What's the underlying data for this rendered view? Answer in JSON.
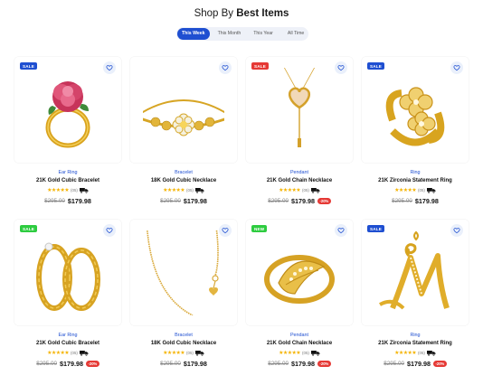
{
  "heading": {
    "prefix": "Shop By",
    "bold": "Best Items"
  },
  "tabs": [
    {
      "label": "This Week",
      "active": true
    },
    {
      "label": "This Month",
      "active": false
    },
    {
      "label": "This Year",
      "active": false
    },
    {
      "label": "All Time",
      "active": false
    }
  ],
  "colors": {
    "accent": "#1f4fd1",
    "sale": "#1f4fd1",
    "hot": "#e53935",
    "sale_green": "#2ecc40",
    "new": "#2ecc40",
    "star": "#f5b301",
    "gold": "#e0a820"
  },
  "products": [
    {
      "badge": "SALE",
      "category": "Ear Ring",
      "name": "21K Gold Cubic Bracelet",
      "stars": "★★★★★",
      "reviews": "(05)",
      "old_price": "$295.00",
      "price": "$179.98",
      "discount": "",
      "icon": "rose-ring-icon"
    },
    {
      "badge": "",
      "category": "Bracelet",
      "name": "18K Gold Cubic Necklace",
      "stars": "★★★★★",
      "reviews": "(05)",
      "old_price": "$295.00",
      "price": "$179.98",
      "discount": "",
      "icon": "flower-bracelet-icon"
    },
    {
      "badge": "SALE",
      "category": "Pendant",
      "name": "21K Gold Chain Necklace",
      "stars": "★★★★★",
      "reviews": "(05)",
      "old_price": "$295.00",
      "price": "$179.98",
      "discount": "-20%",
      "icon": "heart-pendant-icon"
    },
    {
      "badge": "SALE",
      "category": "Ring",
      "name": "21K Zirconia Statement Ring",
      "stars": "★★★★★",
      "reviews": "(05)",
      "old_price": "$295.00",
      "price": "$179.98",
      "discount": "",
      "icon": "clover-ring-icon"
    },
    {
      "badge": "SALE",
      "category": "Ear Ring",
      "name": "21K Gold Cubic Bracelet",
      "stars": "★★★★★",
      "reviews": "(05)",
      "old_price": "$295.00",
      "price": "$179.98",
      "discount": "-20%",
      "icon": "filigree-rings-icon"
    },
    {
      "badge": "",
      "category": "Bracelet",
      "name": "18K Gold Cubic Necklace",
      "stars": "★★★★★",
      "reviews": "(05)",
      "old_price": "$295.00",
      "price": "$179.98",
      "discount": "",
      "icon": "chain-necklace-icon"
    },
    {
      "badge": "NEW",
      "category": "Pendant",
      "name": "21K Gold Chain Necklace",
      "stars": "★★★★★",
      "reviews": "(05)",
      "old_price": "$295.00",
      "price": "$179.98",
      "discount": "-20%",
      "icon": "leaf-ring-icon"
    },
    {
      "badge": "SALE",
      "category": "Ring",
      "name": "21K Zirconia Statement Ring",
      "stars": "★★★★★",
      "reviews": "(05)",
      "old_price": "$295.00",
      "price": "$179.98",
      "discount": "-20%",
      "icon": "letter-m-pendant-icon"
    }
  ]
}
